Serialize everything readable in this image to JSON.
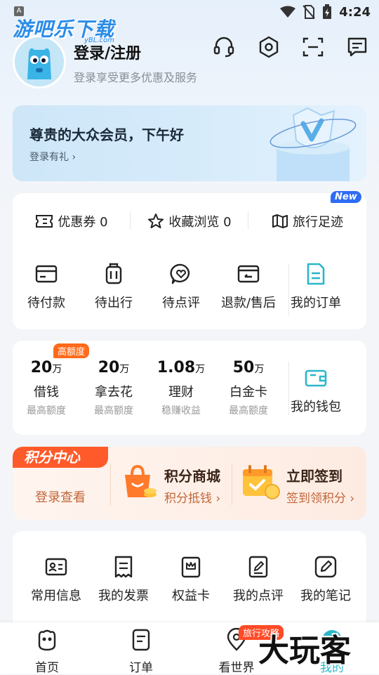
{
  "status_bar": {
    "indicator": "A",
    "time": "4:24"
  },
  "watermark_top": {
    "text": "游吧乐下载",
    "sub": "yBL.com"
  },
  "header": {
    "title": "登录/注册",
    "subtitle": "登录享受更多优惠及服务"
  },
  "member_card": {
    "title": "尊贵的大众会员，下午好",
    "gift_link": "登录有礼 ›"
  },
  "quick_tabs": {
    "items": [
      {
        "label": "优惠券 0",
        "icon": "ticket-icon"
      },
      {
        "label": "收藏浏览 0",
        "icon": "star-icon"
      },
      {
        "label": "旅行足迹",
        "icon": "map-icon"
      }
    ],
    "new_badge": "New"
  },
  "orders": {
    "items": [
      {
        "label": "待付款",
        "icon": "card-icon"
      },
      {
        "label": "待出行",
        "icon": "luggage-icon"
      },
      {
        "label": "待点评",
        "icon": "review-icon"
      },
      {
        "label": "退款/售后",
        "icon": "refund-icon"
      },
      {
        "label": "我的订单",
        "icon": "order-list-icon"
      }
    ]
  },
  "finance": {
    "badge": "高额度",
    "items": [
      {
        "amount": "20",
        "unit": "万",
        "label": "借钱",
        "sub": "最高额度"
      },
      {
        "amount": "20",
        "unit": "万",
        "label": "拿去花",
        "sub": "最高额度"
      },
      {
        "amount": "1.08",
        "unit": "万",
        "label": "理财",
        "sub": "稳赚收益"
      },
      {
        "amount": "50",
        "unit": "万",
        "label": "白金卡",
        "sub": "最高额度"
      }
    ],
    "wallet_label": "我的钱包"
  },
  "points": {
    "tag": "积分中心",
    "login": "登录查看",
    "mall_title": "积分商城",
    "mall_sub": "积分抵钱 ›",
    "checkin_title": "立即签到",
    "checkin_sub": "签到领积分 ›"
  },
  "services": {
    "items": [
      {
        "label": "常用信息",
        "icon": "id-card-icon"
      },
      {
        "label": "我的发票",
        "icon": "invoice-icon"
      },
      {
        "label": "权益卡",
        "icon": "crown-card-icon"
      },
      {
        "label": "我的点评",
        "icon": "edit-doc-icon"
      },
      {
        "label": "我的笔记",
        "icon": "pen-icon"
      }
    ]
  },
  "bottom_nav": {
    "items": [
      {
        "label": "首页"
      },
      {
        "label": "订单"
      },
      {
        "label": "看世界"
      },
      {
        "label": "我的"
      }
    ],
    "travel_badge": "旅行攻略"
  },
  "watermark_bottom": "大玩客",
  "colors": {
    "accent_blue": "#2f6cf5",
    "teal": "#2bb7c9",
    "orange": "#ff5a2a"
  }
}
